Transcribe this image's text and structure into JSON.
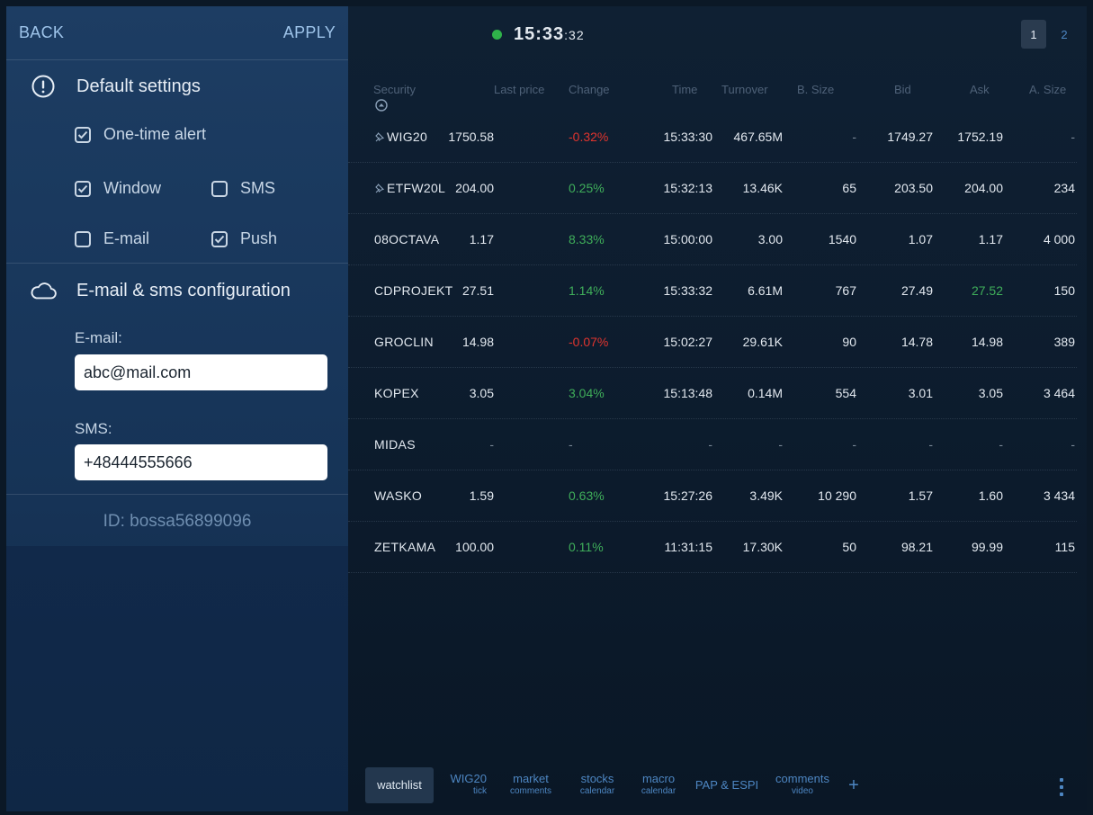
{
  "left_panel": {
    "back_label": "BACK",
    "apply_label": "APPLY",
    "default_settings": {
      "title": "Default settings",
      "one_time_alert": {
        "label": "One-time alert",
        "checked": true
      },
      "window": {
        "label": "Window",
        "checked": true
      },
      "sms": {
        "label": "SMS",
        "checked": false
      },
      "email": {
        "label": "E-mail",
        "checked": false
      },
      "push": {
        "label": "Push",
        "checked": true
      }
    },
    "config": {
      "title": "E-mail & sms configuration",
      "email_label": "E-mail:",
      "email_value": "abc@mail.com",
      "sms_label": "SMS:",
      "sms_value": "+48444555666"
    },
    "user_id": "ID: bossa56899096"
  },
  "header": {
    "clock_hm": "15:33",
    "clock_sec": ":32",
    "status_color": "#2fb24a",
    "pages": [
      "1",
      "2"
    ],
    "active_page": "1"
  },
  "table": {
    "columns": [
      "Security",
      "Last price",
      "Change",
      "Time",
      "Turnover",
      "B. Size",
      "Bid",
      "Ask",
      "A. Size"
    ],
    "rows": [
      {
        "security": "WIG20",
        "pinned": true,
        "last": "1750.58",
        "change": "-0.32%",
        "trend": "neg",
        "time": "15:33:30",
        "turnover": "467.65M",
        "bsize": "-",
        "bid": "1749.27",
        "ask": "1752.19",
        "asize": "-"
      },
      {
        "security": "ETFW20L",
        "pinned": true,
        "last": "204.00",
        "change": "0.25%",
        "trend": "pos",
        "time": "15:32:13",
        "turnover": "13.46K",
        "bsize": "65",
        "bid": "203.50",
        "ask": "204.00",
        "asize": "234"
      },
      {
        "security": "08OCTAVA",
        "pinned": false,
        "last": "1.17",
        "change": "8.33%",
        "trend": "pos",
        "time": "15:00:00",
        "turnover": "3.00",
        "bsize": "1540",
        "bid": "1.07",
        "ask": "1.17",
        "asize": "4 000"
      },
      {
        "security": "CDPROJEKT",
        "pinned": false,
        "last": "27.51",
        "change": "1.14%",
        "trend": "pos",
        "time": "15:33:32",
        "turnover": "6.61M",
        "bsize": "767",
        "bid": "27.49",
        "ask": "27.52",
        "asize": "150",
        "ask_highlight": true
      },
      {
        "security": "GROCLIN",
        "pinned": false,
        "last": "14.98",
        "change": "-0.07%",
        "trend": "neg",
        "time": "15:02:27",
        "turnover": "29.61K",
        "bsize": "90",
        "bid": "14.78",
        "ask": "14.98",
        "asize": "389"
      },
      {
        "security": "KOPEX",
        "pinned": false,
        "last": "3.05",
        "change": "3.04%",
        "trend": "pos",
        "time": "15:13:48",
        "turnover": "0.14M",
        "bsize": "554",
        "bid": "3.01",
        "ask": "3.05",
        "asize": "3 464"
      },
      {
        "security": "MIDAS",
        "pinned": false,
        "last": "-",
        "change": "-",
        "trend": "none",
        "time": "-",
        "turnover": "-",
        "bsize": "-",
        "bid": "-",
        "ask": "-",
        "asize": "-"
      },
      {
        "security": "WASKO",
        "pinned": false,
        "last": "1.59",
        "change": "0.63%",
        "trend": "pos",
        "time": "15:27:26",
        "turnover": "3.49K",
        "bsize": "10 290",
        "bid": "1.57",
        "ask": "1.60",
        "asize": "3 434"
      },
      {
        "security": "ZETKAMA",
        "pinned": false,
        "last": "100.00",
        "change": "0.11%",
        "trend": "pos",
        "time": "11:31:15",
        "turnover": "17.30K",
        "bsize": "50",
        "bid": "98.21",
        "ask": "99.99",
        "asize": "115"
      }
    ]
  },
  "tabs": [
    {
      "label": "watchlist",
      "sub": "",
      "active": true
    },
    {
      "label": "WIG20",
      "sub": "tick",
      "active": false
    },
    {
      "label": "market",
      "sub": "comments",
      "active": false
    },
    {
      "label": "stocks",
      "sub": "calendar",
      "active": false
    },
    {
      "label": "macro",
      "sub": "calendar",
      "active": false
    },
    {
      "label": "PAP & ESPI",
      "sub": "",
      "active": false
    },
    {
      "label": "comments",
      "sub": "video",
      "active": false
    },
    {
      "label": "+",
      "sub": "",
      "active": false
    }
  ]
}
